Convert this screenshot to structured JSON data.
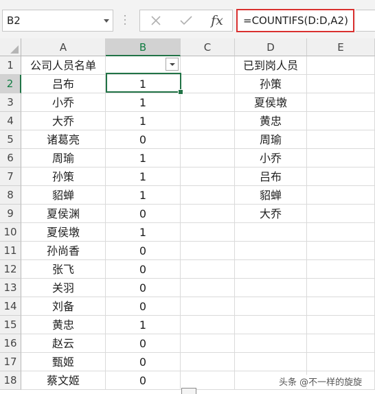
{
  "formula_bar": {
    "name_box": "B2",
    "fx_label": "fx",
    "formula": "=COUNTIFS(D:D,A2)"
  },
  "columns": [
    "A",
    "B",
    "C",
    "D",
    "E"
  ],
  "selected_column": "B",
  "rows": [
    {
      "num": "1",
      "a": "公司人员名单",
      "b": "",
      "d": "已到岗人员"
    },
    {
      "num": "2",
      "a": "吕布",
      "b": "1",
      "d": "孙策"
    },
    {
      "num": "3",
      "a": "小乔",
      "b": "1",
      "d": "夏侯墩"
    },
    {
      "num": "4",
      "a": "大乔",
      "b": "1",
      "d": "黄忠"
    },
    {
      "num": "5",
      "a": "诸葛亮",
      "b": "0",
      "d": "周瑜"
    },
    {
      "num": "6",
      "a": "周瑜",
      "b": "1",
      "d": "小乔"
    },
    {
      "num": "7",
      "a": "孙策",
      "b": "1",
      "d": "吕布"
    },
    {
      "num": "8",
      "a": "貂蝉",
      "b": "1",
      "d": "貂蝉"
    },
    {
      "num": "9",
      "a": "夏侯渊",
      "b": "0",
      "d": "大乔"
    },
    {
      "num": "10",
      "a": "夏侯墩",
      "b": "1",
      "d": ""
    },
    {
      "num": "11",
      "a": "孙尚香",
      "b": "0",
      "d": ""
    },
    {
      "num": "12",
      "a": "张飞",
      "b": "0",
      "d": ""
    },
    {
      "num": "13",
      "a": "关羽",
      "b": "0",
      "d": ""
    },
    {
      "num": "14",
      "a": "刘备",
      "b": "0",
      "d": ""
    },
    {
      "num": "15",
      "a": "黄忠",
      "b": "1",
      "d": ""
    },
    {
      "num": "16",
      "a": "赵云",
      "b": "0",
      "d": ""
    },
    {
      "num": "17",
      "a": "甄姬",
      "b": "0",
      "d": ""
    },
    {
      "num": "18",
      "a": "蔡文姬",
      "b": "0",
      "d": ""
    }
  ],
  "watermark": "头条 @不一样的旋旋",
  "colors": {
    "accent_green": "#217346",
    "formula_highlight": "#d9302f"
  }
}
